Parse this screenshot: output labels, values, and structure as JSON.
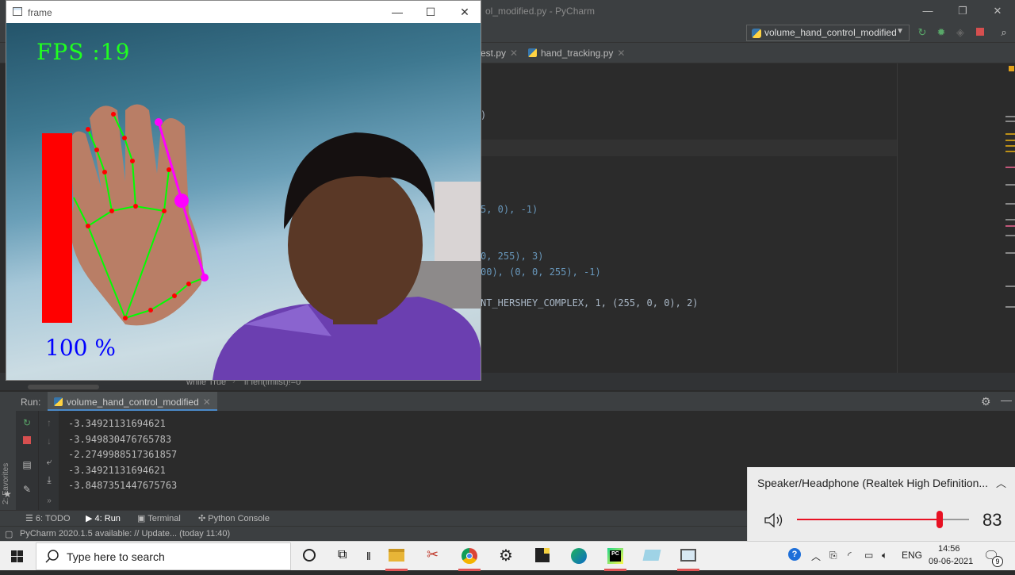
{
  "ide": {
    "title": "ol_modified.py - PyCharm",
    "run_config": "volume_hand_control_modified",
    "tabs": [
      {
        "label": "est.py"
      },
      {
        "label": "hand_tracking.py"
      }
    ],
    "code_lines": [
      ")",
      "5, 0), -1)",
      "0, 255), 3)",
      "00), (0, 0, 255), -1)",
      "NT_HERSHEY_COMPLEX, 1, (255, 0, 0), 2)"
    ],
    "breadcrumb": [
      "while True",
      "if len(lmlist)!=0"
    ],
    "run_label": "Run:",
    "run_tab": "volume_hand_control_modified",
    "console_lines": [
      "-3.34921131694621",
      "-3.949830476765783",
      "-2.2749988517361857",
      "-3.34921131694621",
      "-3.8487351447675763"
    ],
    "favorites": "2: Favorites",
    "bottom_tools": {
      "todo": "6: TODO",
      "run": "4: Run",
      "terminal": "Terminal",
      "python_console": "Python Console"
    },
    "status": "PyCharm 2020.1.5 available: // Update... (today 11:40)"
  },
  "frame": {
    "title": "frame",
    "fps_text": "FPS :19",
    "volume_percent_text": "100 %",
    "volume_bar_level": 1.0
  },
  "volume_flyout": {
    "device": "Speaker/Headphone (Realtek High Definition...",
    "value": "83",
    "level": 0.83
  },
  "taskbar": {
    "search_placeholder": "Type here to search",
    "language": "ENG",
    "time": "14:56",
    "date": "09-06-2021",
    "notification_count": "9"
  },
  "colors": {
    "accent": "#e81123",
    "fps_green": "#20ff20",
    "landmark_red": "#ff0000",
    "line_green": "#00ff00",
    "pinch_magenta": "#ff00ff",
    "percent_blue": "#0000ff"
  }
}
